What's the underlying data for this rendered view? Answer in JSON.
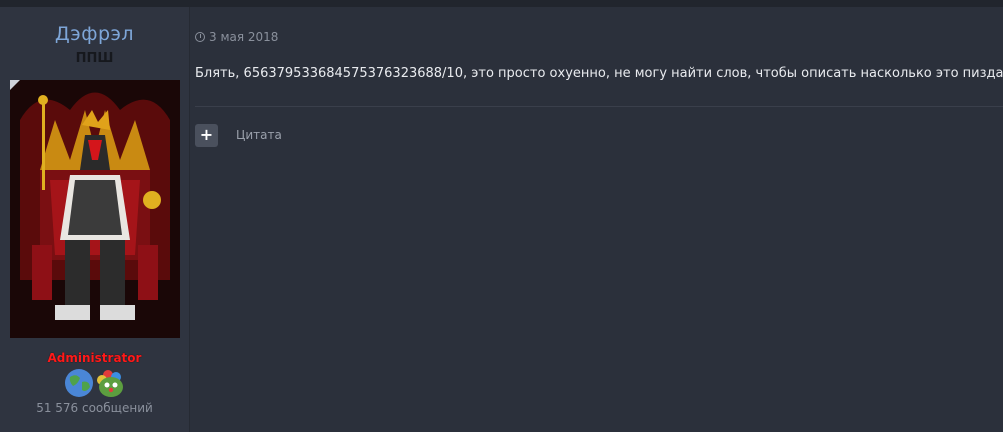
{
  "author": {
    "username": "Дэфрэл",
    "title": "ППШ",
    "group": "Administrator",
    "posts": "51 576 сообщений",
    "badges": [
      "globe-icon",
      "pepe-clown-icon"
    ]
  },
  "post": {
    "date": "3 мая 2018",
    "text": "Блять, 656379533684575376323688/10, это просто охуенно, не могу найти слов, чтобы описать насколько это пиздато",
    "quote_button": "+",
    "quote_label": "Цитата"
  },
  "colors": {
    "background": "#2b303b",
    "username": "#7ea6d8",
    "group": "#ff1a1a"
  }
}
